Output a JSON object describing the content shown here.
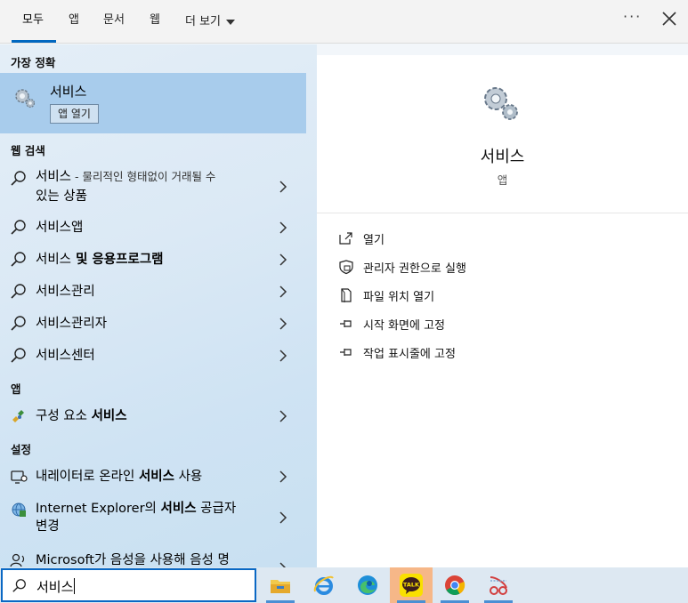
{
  "tabs": [
    {
      "label": "모두",
      "active": true
    },
    {
      "label": "앱"
    },
    {
      "label": "문서"
    },
    {
      "label": "웹"
    },
    {
      "label": "더 보기"
    }
  ],
  "top_actions": {
    "more": "···"
  },
  "sections": {
    "best_match": "가장 정확",
    "web_search": "웹 검색",
    "apps": "앱",
    "settings": "설정"
  },
  "best_match": {
    "title": "서비스",
    "button": "앱 열기"
  },
  "web_results": [
    {
      "bold": "서비스",
      "rest": " - ",
      "sub": "물리적인 형태없이 거래될 수",
      "line2": "있는 상품"
    },
    {
      "bold": "서비스앱"
    },
    {
      "bold": "서비스",
      "rest": " 및 응용프로그램"
    },
    {
      "bold": "서비스관리"
    },
    {
      "bold": "서비스관리자"
    },
    {
      "bold": "서비스센터"
    }
  ],
  "app_results": [
    {
      "pre": "구성 요소 ",
      "bold": "서비스"
    }
  ],
  "settings_results": [
    {
      "pre": "내레이터로 온라인 ",
      "bold": "서비스",
      "post": " 사용"
    },
    {
      "pre": "Internet Explorer의 ",
      "bold": "서비스",
      "post": " 공급자",
      "line2": "변경"
    },
    {
      "pre": "Microsoft가 음성을 사용해 음성 명"
    }
  ],
  "detail": {
    "title": "서비스",
    "subtitle": "앱",
    "actions": [
      "열기",
      "관리자 권한으로 실행",
      "파일 위치 열기",
      "시작 화면에 고정",
      "작업 표시줄에 고정"
    ]
  },
  "search": {
    "query": "서비스"
  },
  "taskbar_apps": [
    "file-explorer-icon",
    "internet-explorer-icon",
    "edge-icon",
    "kakaotalk-icon",
    "chrome-icon",
    "snipping-tool-icon"
  ],
  "kakaotalk_label": "TALK",
  "colors": {
    "accent": "#0067c0",
    "selected": "#a8ccec",
    "kakao": "#f9e000"
  }
}
